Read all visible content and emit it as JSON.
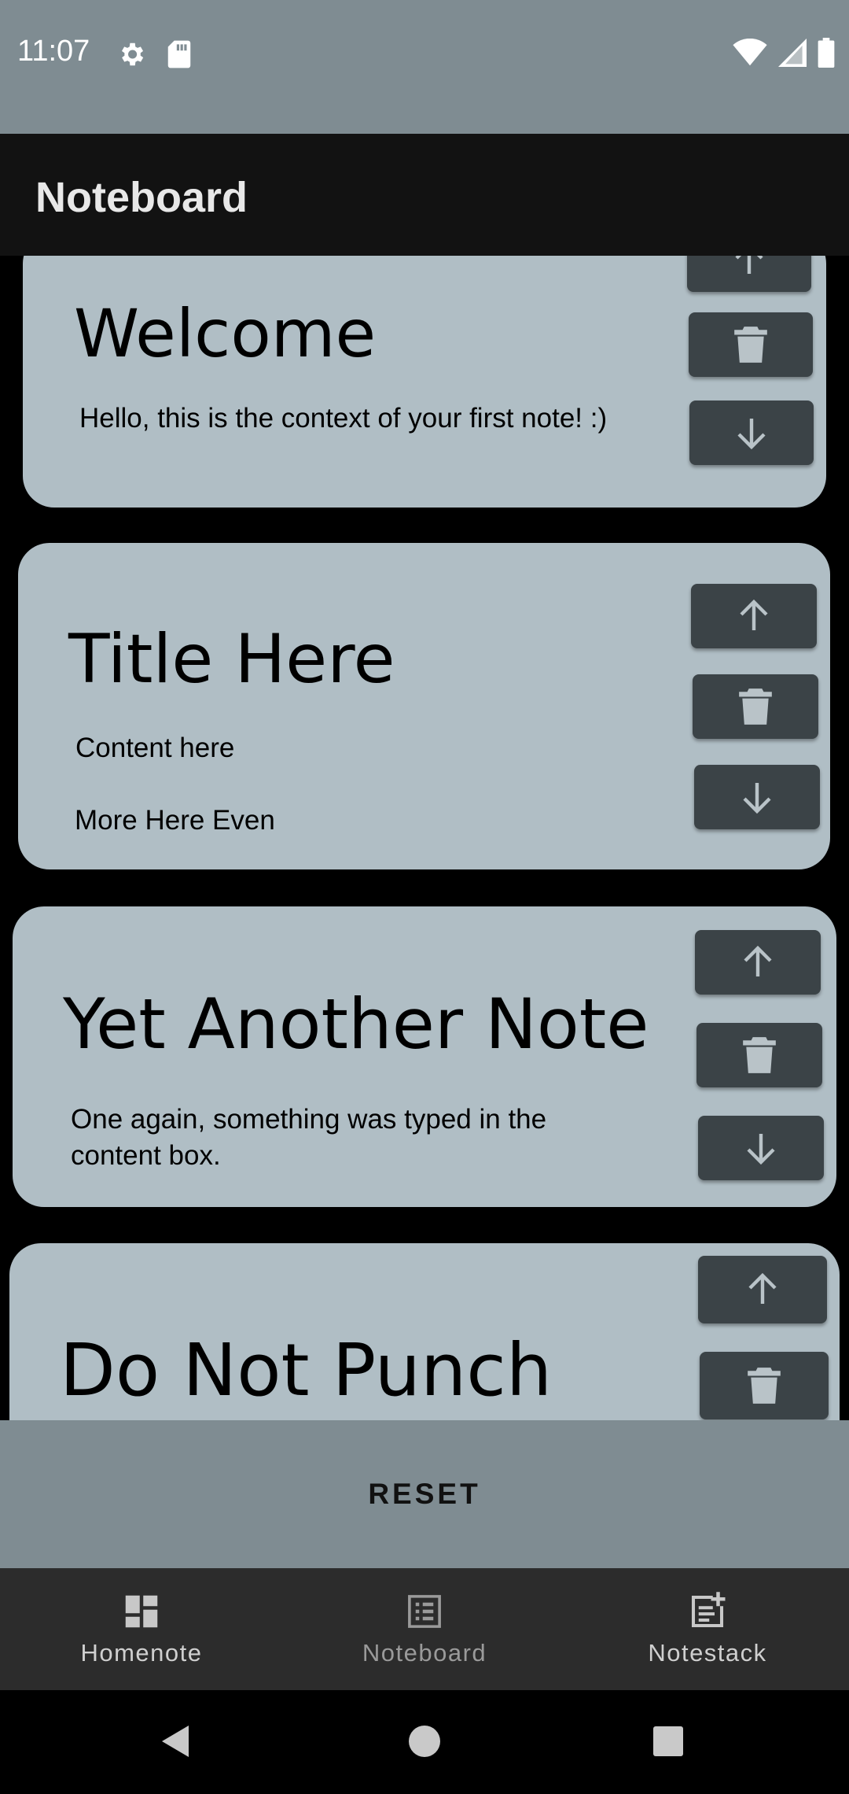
{
  "status_bar": {
    "time": "11:07",
    "left_icons": [
      "gear-icon",
      "sd-card-icon"
    ],
    "right_icons": [
      "wifi-icon",
      "signal-icon",
      "battery-icon"
    ]
  },
  "app_bar": {
    "title": "Noteboard"
  },
  "notes": [
    {
      "title": "Welcome",
      "content": [
        "Hello, this is the context of your first note! :)"
      ]
    },
    {
      "title": "Title Here",
      "content": [
        "Content here",
        "More Here Even"
      ]
    },
    {
      "title": "Yet Another Note",
      "content": [
        "One again, something was typed in the content box."
      ]
    },
    {
      "title": "Do Not Punch",
      "content": []
    }
  ],
  "controls": {
    "up_icon": "arrow-up-icon",
    "delete_icon": "trash-icon",
    "down_icon": "arrow-down-icon"
  },
  "reset": {
    "label": "RESET"
  },
  "bottom_nav": {
    "items": [
      {
        "label": "Homenote",
        "icon": "dashboard-icon",
        "selected": false
      },
      {
        "label": "Noteboard",
        "icon": "list-icon",
        "selected": true
      },
      {
        "label": "Notestack",
        "icon": "note-add-icon",
        "selected": false
      }
    ]
  },
  "colors": {
    "card": "#b0bec5",
    "button": "#3b4347",
    "status_bar": "#7f8c92",
    "app_bar": "#121212",
    "bottom_nav": "#2c2c2c"
  }
}
